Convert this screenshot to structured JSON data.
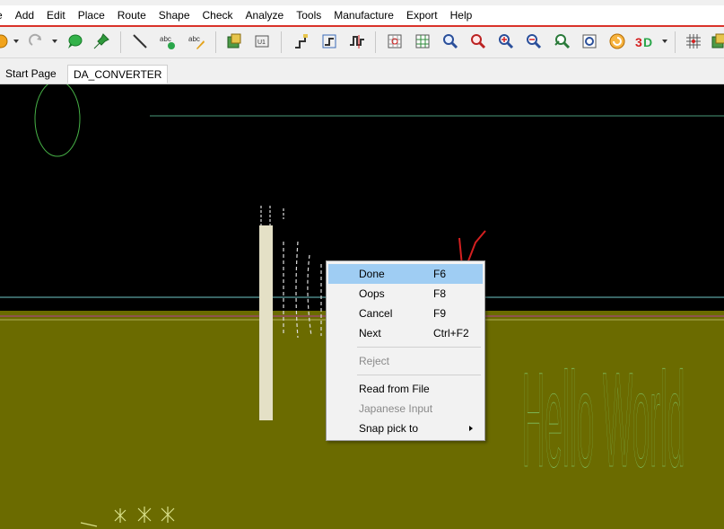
{
  "window": {
    "title_fragment": ""
  },
  "menu": [
    {
      "label": "e"
    },
    {
      "label": "Add"
    },
    {
      "label": "Edit"
    },
    {
      "label": "Place"
    },
    {
      "label": "Route"
    },
    {
      "label": "Shape"
    },
    {
      "label": "Check"
    },
    {
      "label": "Analyze"
    },
    {
      "label": "Tools"
    },
    {
      "label": "Manufacture"
    },
    {
      "label": "Export"
    },
    {
      "label": "Help"
    }
  ],
  "toolbar_icons": [
    "open-icon",
    "redo-icon",
    "highlight-icon",
    "pin-icon",
    "add-line-icon",
    "add-text-icon",
    "edit-text-icon",
    "place-component-icon",
    "place-u1-icon",
    "add-connect-icon",
    "slide-icon",
    "delay-tune-icon",
    "grid-icon",
    "zoom-fit-icon",
    "zoom-points-icon",
    "zoom-world-icon",
    "zoom-in-icon",
    "zoom-out-icon",
    "zoom-previous-icon",
    "redraw-icon",
    "refresh-icon",
    "3d-view-icon",
    "grid-toggle-icon"
  ],
  "tabs": [
    {
      "label": "Start Page",
      "active": false
    },
    {
      "label": "DA_CONVERTER",
      "active": true
    }
  ],
  "canvas": {
    "background": "#000000",
    "board_color": "#6b6b00",
    "silkscreen_text": "Hello World"
  },
  "context_menu": {
    "items": [
      {
        "label": "Done",
        "accel": "F6",
        "highlighted": true,
        "disabled": false
      },
      {
        "label": "Oops",
        "accel": "F8",
        "highlighted": false,
        "disabled": false
      },
      {
        "label": "Cancel",
        "accel": "F9",
        "highlighted": false,
        "disabled": false
      },
      {
        "label": "Next",
        "accel": "Ctrl+F2",
        "highlighted": false,
        "disabled": false
      },
      {
        "label": "Reject",
        "accel": "",
        "highlighted": false,
        "disabled": true
      },
      {
        "label": "Read from File",
        "accel": "",
        "highlighted": false,
        "disabled": false
      },
      {
        "label": "Japanese Input",
        "accel": "",
        "highlighted": false,
        "disabled": true
      },
      {
        "label": "Snap pick to",
        "accel": "",
        "highlighted": false,
        "disabled": false,
        "submenu": true
      }
    ]
  },
  "colors": {
    "menu_accent": "#d9322a",
    "highlight": "#9fcdf3",
    "annotation": "#d42020"
  }
}
